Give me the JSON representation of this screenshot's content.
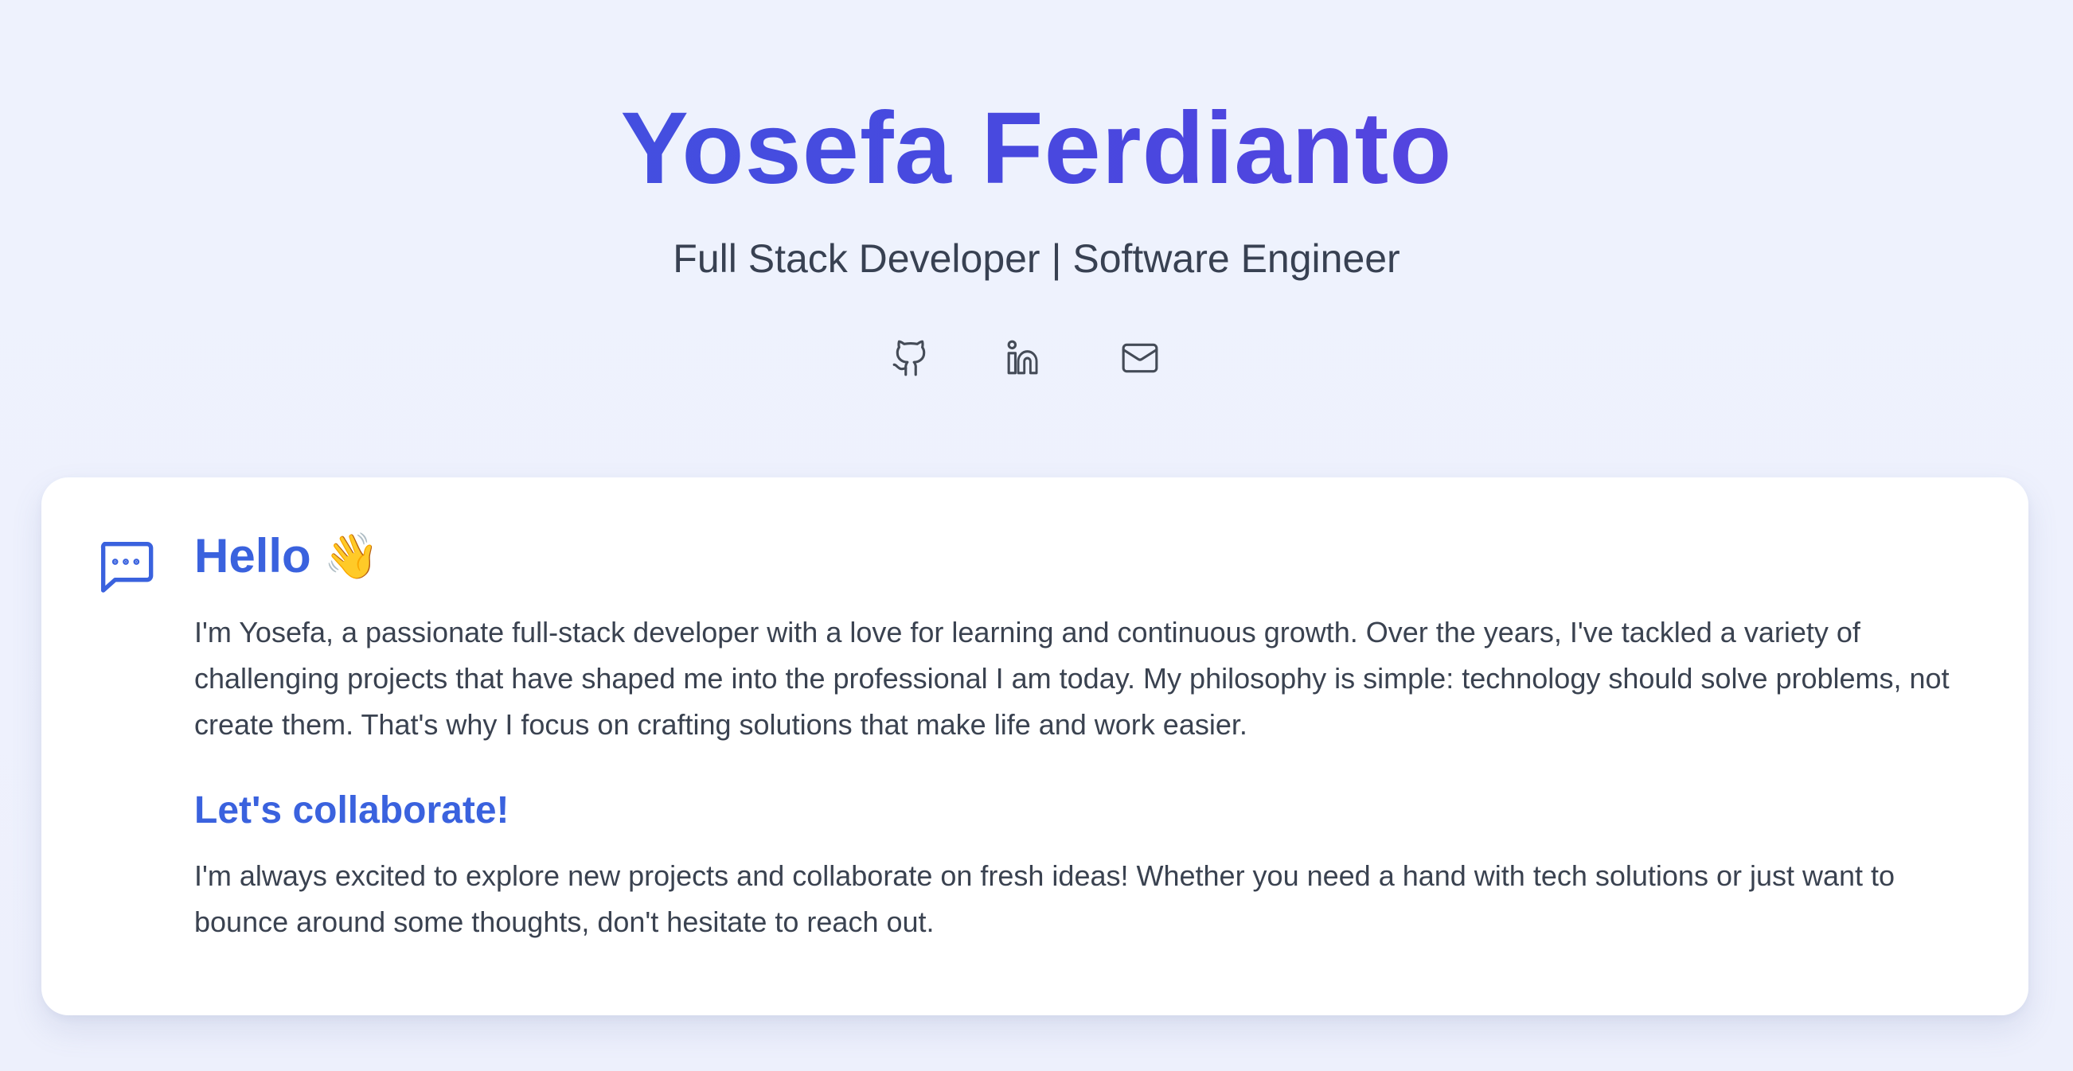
{
  "hero": {
    "name": "Yosefa Ferdianto",
    "tagline": "Full Stack Developer | Software Engineer",
    "socials": [
      {
        "icon": "github-icon",
        "label": "GitHub"
      },
      {
        "icon": "linkedin-icon",
        "label": "LinkedIn"
      },
      {
        "icon": "mail-icon",
        "label": "Email"
      }
    ]
  },
  "about": {
    "icon": "chat-bubble-icon",
    "heading": "Hello",
    "heading_emoji": "👋",
    "intro": "I'm Yosefa, a passionate full-stack developer with a love for learning and continuous growth. Over the years, I've tackled a variety of challenging projects that have shaped me into the professional I am today. My philosophy is simple: technology should solve problems, not create them. That's why I focus on crafting solutions that make life and work easier.",
    "subheading": "Let's collaborate!",
    "outro": "I'm always excited to explore new projects and collaborate on fresh ideas! Whether you need a hand with tech solutions or just want to bounce around some thoughts, don't hesitate to reach out."
  },
  "colors": {
    "accent": "#3a62de",
    "text": "#3a4250",
    "background": "#eef2fd",
    "card": "#ffffff"
  }
}
